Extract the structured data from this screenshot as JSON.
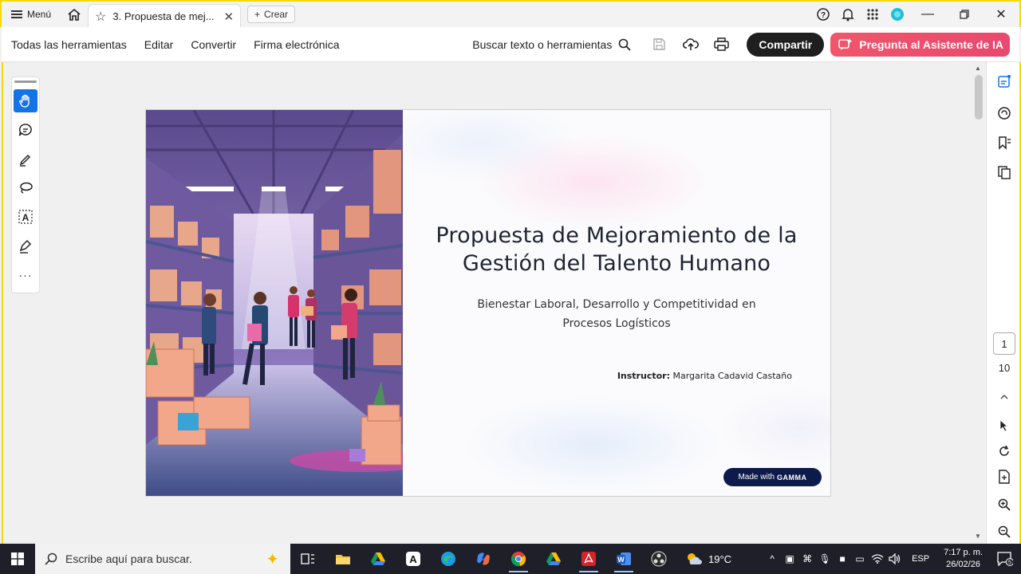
{
  "titlebar": {
    "menu_label": "Menú",
    "tab_title": "3. Propuesta de mej...",
    "create_label": "Crear"
  },
  "toolbar": {
    "items": [
      "Todas las herramientas",
      "Editar",
      "Convertir",
      "Firma electrónica"
    ],
    "search_tools": "Buscar texto o herramientas",
    "share_label": "Compartir",
    "ai_label": "Pregunta al Asistente de IA"
  },
  "slide": {
    "title": "Propuesta de Mejoramiento de la Gestión del Talento Humano",
    "subtitle": "Bienestar Laboral, Desarrollo y Competitividad en Procesos Logísticos",
    "instructor_label": "Instructor:",
    "instructor_name": "Margarita Cadavid Castaño",
    "badge_prefix": "Made with",
    "badge_brand": "GAMMA"
  },
  "page_nav": {
    "current": "1",
    "total": "10"
  },
  "taskbar": {
    "search_placeholder": "Escribe aquí para buscar.",
    "weather": "19°C",
    "language": "ESP",
    "time": "7:17 p. m.",
    "date": "26/02/26",
    "notification_count": "5"
  },
  "colors": {
    "accent_blue": "#1473e6",
    "ai_button": "#e8496e",
    "share_button": "#1f1f1f",
    "border_highlight": "#f5d90a",
    "gamma_badge": "#0d1b4a"
  }
}
